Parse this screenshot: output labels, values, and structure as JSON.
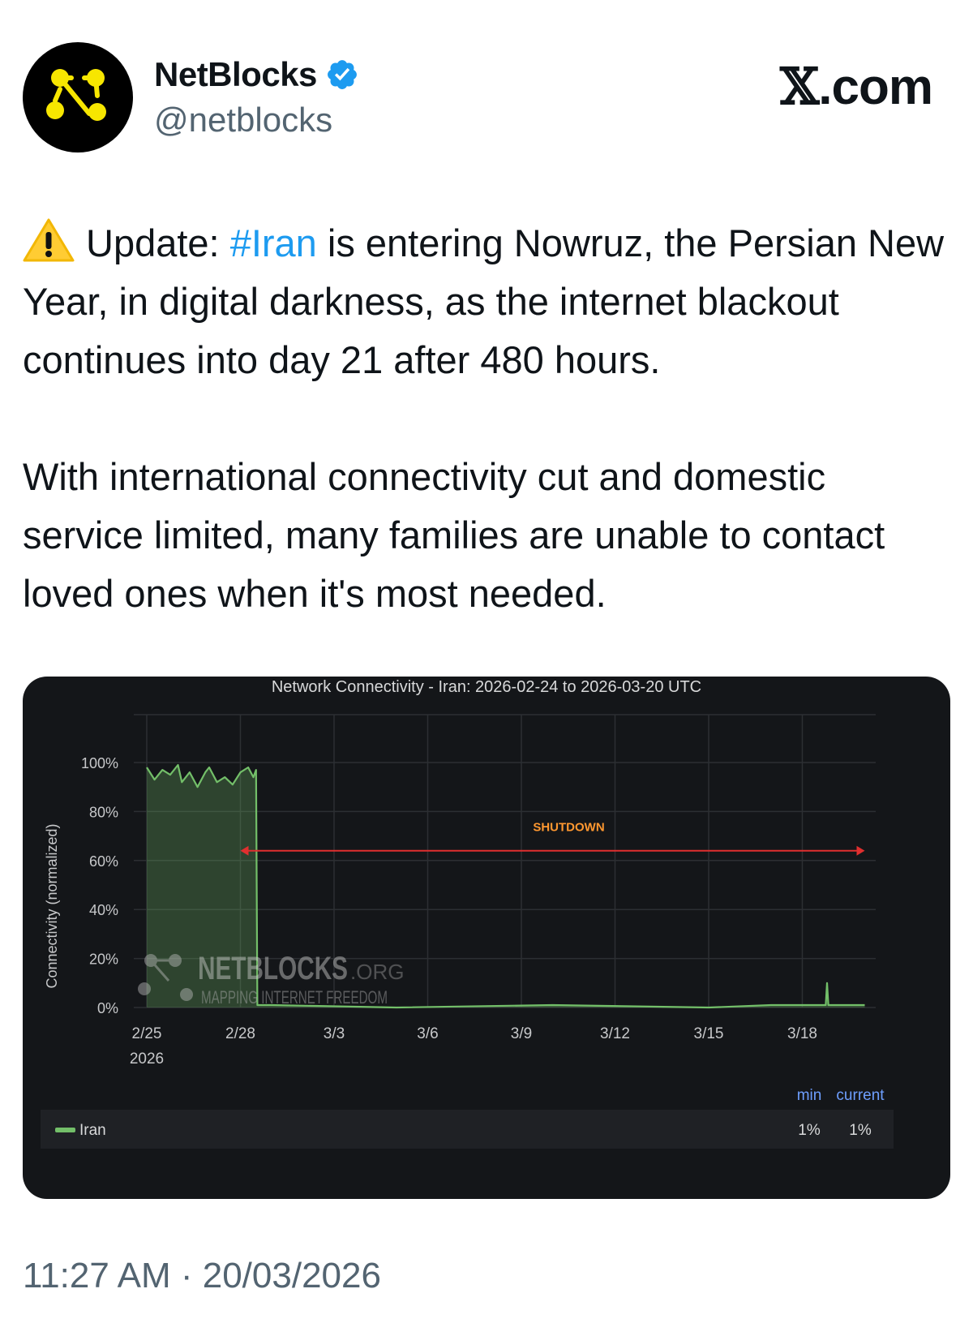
{
  "account": {
    "name": "NetBlocks",
    "handle": "@netblocks",
    "verified": true,
    "avatar_icon": "netblocks-logo-icon"
  },
  "site_label": {
    "glyph": "𝕏",
    "suffix": ".com"
  },
  "tweet": {
    "warning_icon": "warning-icon",
    "p1_before": "Update: ",
    "p1_hashtag": "#Iran",
    "p1_after": " is entering Nowruz, the Persian New Year, in digital darkness, as the internet blackout continues into day 21 after 480 hours.",
    "p2": "With international connectivity cut and domestic service limited, many families are unable to contact loved ones when it's most needed.",
    "timestamp": "11:27 AM · 20/03/2026"
  },
  "colors": {
    "hashtag": "#1d9bf0",
    "verified": "#1d9bf0",
    "chart_bg": "#141619",
    "series": "#73bf69",
    "shutdown": "#e02f2f",
    "shutdown_label": "#ff9830",
    "legend_header": "#6e9fff"
  },
  "chart_data": {
    "type": "area",
    "title": "Network Connectivity - Iran: 2026-02-24 to 2026-03-20 UTC",
    "ylabel": "Connectivity (normalized)",
    "xlabel": "",
    "ylim": [
      0,
      100
    ],
    "yticks": [
      "100%",
      "80%",
      "60%",
      "40%",
      "20%",
      "0%"
    ],
    "ytick_values": [
      100,
      80,
      60,
      40,
      20,
      0
    ],
    "xlim": [
      "2026-02-24",
      "2026-03-20"
    ],
    "xticks": [
      "2/25",
      "2/28",
      "3/3",
      "3/6",
      "3/9",
      "3/12",
      "3/15",
      "3/18"
    ],
    "xtick_dates": [
      "2026-02-25",
      "2026-02-28",
      "2026-03-03",
      "2026-03-06",
      "2026-03-09",
      "2026-03-12",
      "2026-03-15",
      "2026-03-18"
    ],
    "xtick_year": "2026",
    "grid": true,
    "series": [
      {
        "name": "Iran",
        "points": [
          [
            "2026-02-25",
            98
          ],
          [
            "2026-02-25T06:00",
            93
          ],
          [
            "2026-02-25T12:00",
            97
          ],
          [
            "2026-02-25T18:00",
            95
          ],
          [
            "2026-02-26",
            99
          ],
          [
            "2026-02-26T03:00",
            92
          ],
          [
            "2026-02-26T09:00",
            96
          ],
          [
            "2026-02-26T15:00",
            90
          ],
          [
            "2026-02-26T21:00",
            96
          ],
          [
            "2026-02-27",
            98
          ],
          [
            "2026-02-27T06:00",
            92
          ],
          [
            "2026-02-27T12:00",
            94
          ],
          [
            "2026-02-27T18:00",
            91
          ],
          [
            "2026-02-28",
            96
          ],
          [
            "2026-02-28T06:00",
            98
          ],
          [
            "2026-02-28T10:00",
            94
          ],
          [
            "2026-02-28T12:00",
            97
          ],
          [
            "2026-02-28T13:00",
            1
          ],
          [
            "2026-03-01",
            1
          ],
          [
            "2026-03-05",
            0
          ],
          [
            "2026-03-10",
            1
          ],
          [
            "2026-03-15",
            0
          ],
          [
            "2026-03-17",
            1
          ],
          [
            "2026-03-18T18:00",
            1
          ],
          [
            "2026-03-18T19:00",
            10
          ],
          [
            "2026-03-18T20:00",
            1
          ],
          [
            "2026-03-20",
            1
          ]
        ],
        "min": "1%",
        "current": "1%"
      }
    ],
    "annotation": {
      "label": "SHUTDOWN",
      "from": "2026-02-28",
      "to": "2026-03-20",
      "y": 64
    },
    "watermark": {
      "brand": "NETBLOCKS",
      "suffix": ".ORG",
      "tagline": "MAPPING INTERNET FREEDOM"
    },
    "legend": {
      "placement": "bottom",
      "headers": [
        "min",
        "current"
      ]
    }
  }
}
